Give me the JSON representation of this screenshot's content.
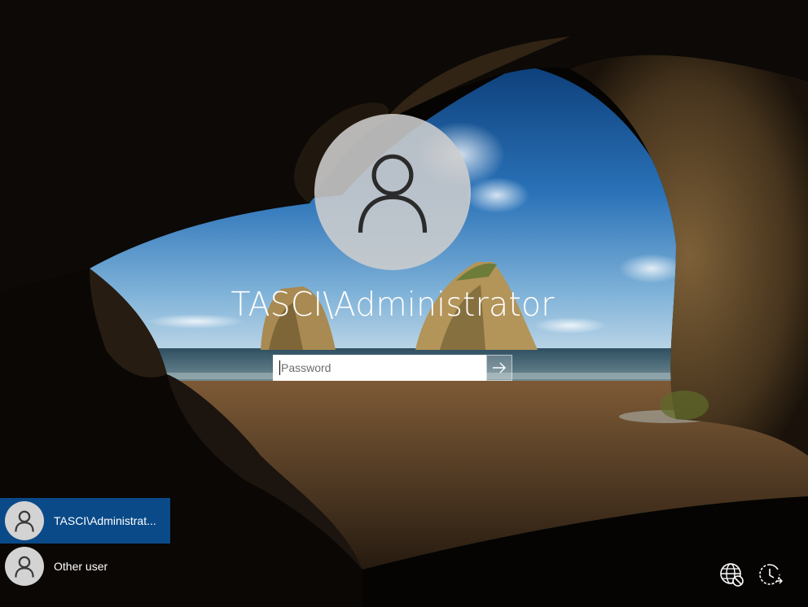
{
  "login": {
    "username": "TASCI\\Administrator",
    "password_placeholder": "Password",
    "password_value": ""
  },
  "user_list": {
    "items": [
      {
        "label": "TASCI\\Administrat...",
        "selected": true
      },
      {
        "label": "Other user",
        "selected": false
      }
    ]
  },
  "tray": {
    "network_icon": "network-globe-icon",
    "ease_of_access_icon": "ease-of-access-icon"
  },
  "colors": {
    "selected_user_bg": "#0a4a88",
    "avatar_bg": "#cdcdcd",
    "text": "#ffffff"
  }
}
